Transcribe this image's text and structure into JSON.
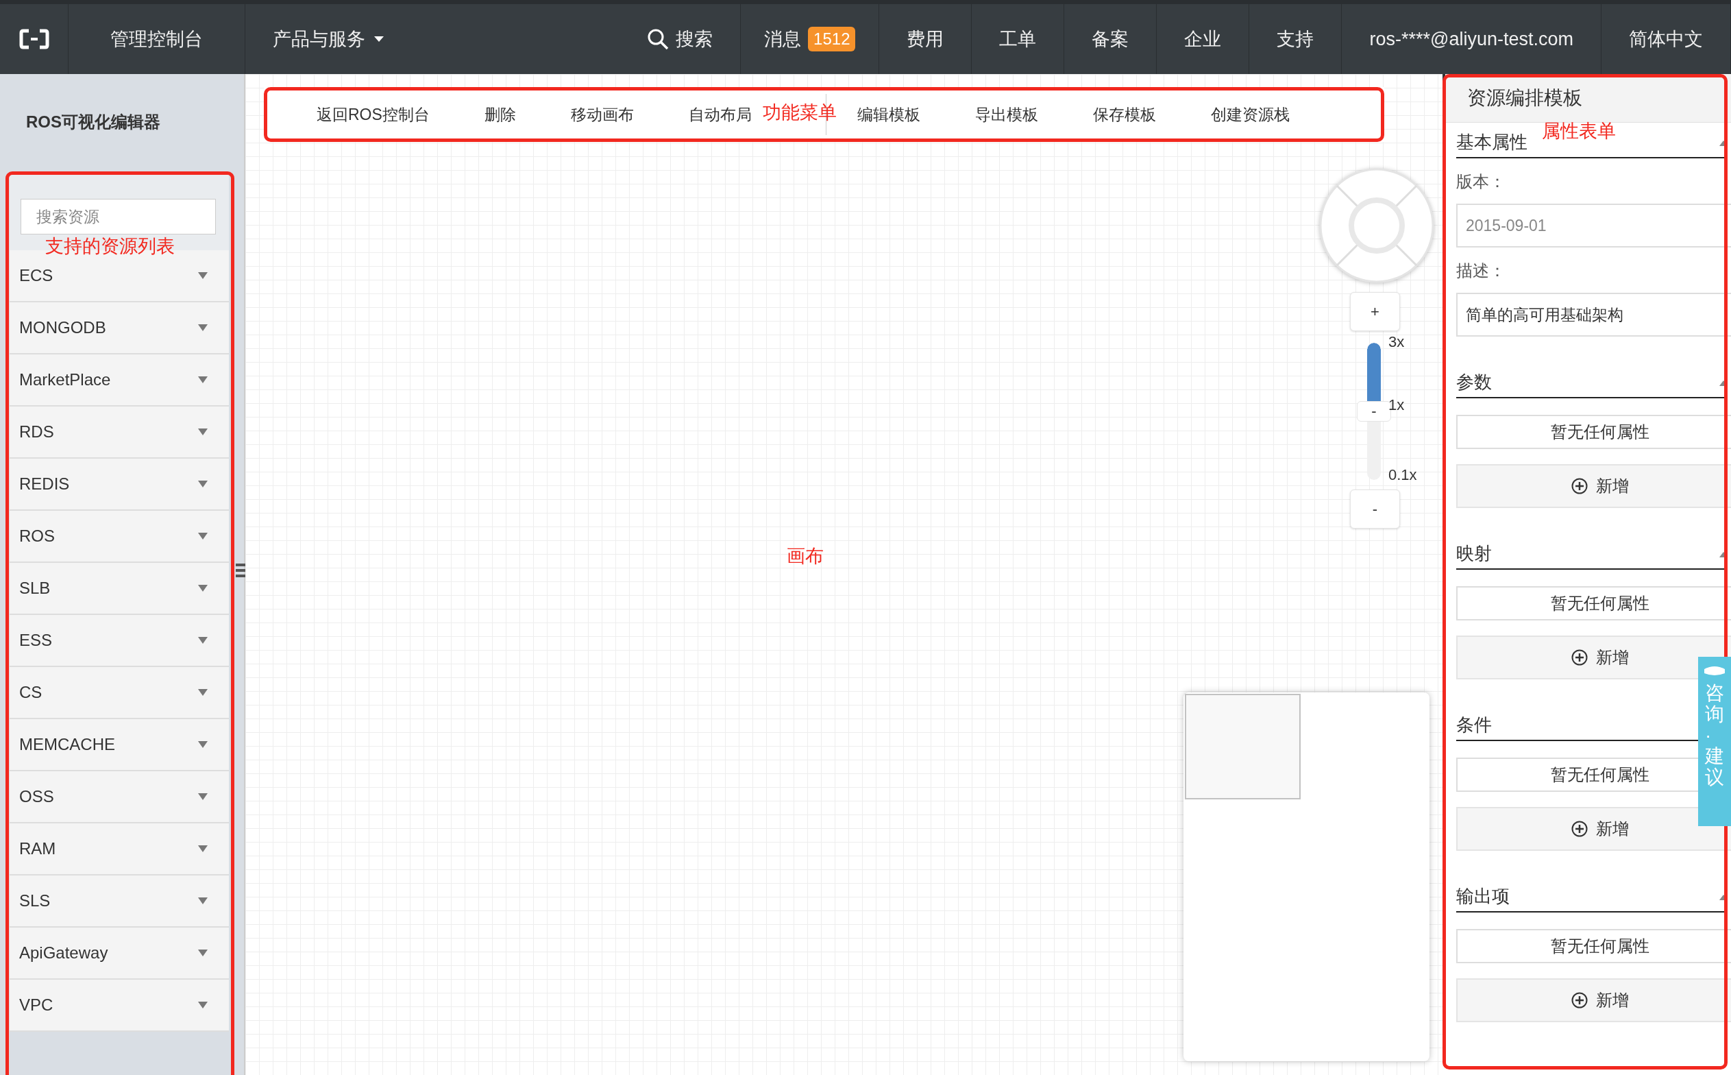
{
  "topbar": {
    "items": [
      {
        "kind": "logo"
      },
      {
        "kind": "link",
        "label": "管理控制台"
      },
      {
        "kind": "dropdown",
        "label": "产品与服务"
      },
      {
        "kind": "search",
        "label": "搜索"
      },
      {
        "kind": "badge",
        "label": "消息",
        "badge": "1512"
      },
      {
        "kind": "link",
        "label": "费用"
      },
      {
        "kind": "link",
        "label": "工单"
      },
      {
        "kind": "link",
        "label": "备案"
      },
      {
        "kind": "link",
        "label": "企业"
      },
      {
        "kind": "link",
        "label": "支持"
      },
      {
        "kind": "link",
        "label": "ros-****@aliyun-test.com"
      },
      {
        "kind": "link",
        "label": "简体中文"
      }
    ]
  },
  "sidebar": {
    "title": "ROS可视化编辑器",
    "search": {
      "placeholder": "搜索资源"
    },
    "annotation": "支持的资源列表",
    "items": [
      {
        "label": "ECS",
        "expanded": false
      },
      {
        "label": "MONGODB",
        "expanded": false
      },
      {
        "label": "MarketPlace",
        "expanded": false
      },
      {
        "label": "RDS",
        "expanded": false
      },
      {
        "label": "REDIS",
        "expanded": false
      },
      {
        "label": "ROS",
        "expanded": false
      },
      {
        "label": "SLB",
        "expanded": false
      },
      {
        "label": "ESS",
        "expanded": false
      },
      {
        "label": "CS",
        "expanded": false
      },
      {
        "label": "MEMCACHE",
        "expanded": false
      },
      {
        "label": "OSS",
        "expanded": false
      },
      {
        "label": "RAM",
        "expanded": false
      },
      {
        "label": "SLS",
        "expanded": false
      },
      {
        "label": "ApiGateway",
        "expanded": false
      },
      {
        "label": "VPC",
        "expanded": false
      }
    ]
  },
  "toolbar": {
    "annotation": "功能菜单",
    "buttons": [
      "返回ROS控制台",
      "删除",
      "移动画布",
      "自动布局",
      "编辑模板",
      "导出模板",
      "保存模板",
      "创建资源栈"
    ]
  },
  "canvas": {
    "annotation": "画布",
    "zoom": {
      "zoom_in": "+",
      "zoom_out": "-",
      "thumb": "-",
      "max_label": "3x",
      "mid_label": "1x",
      "min_label": "0.1x",
      "level": 0.5
    }
  },
  "properties": {
    "title": "资源编排模板",
    "annotation": "属性表单",
    "sections": [
      {
        "kind": "fields",
        "title": "基本属性",
        "fields": [
          {
            "label": "版本：",
            "placeholder": "2015-09-01"
          },
          {
            "label": "描述：",
            "value": "简单的高可用基础架构"
          }
        ]
      },
      {
        "kind": "list",
        "title": "参数",
        "empty": "暂无任何属性",
        "add": "新增"
      },
      {
        "kind": "list",
        "title": "映射",
        "empty": "暂无任何属性",
        "add": "新增"
      },
      {
        "kind": "list",
        "title": "条件",
        "empty": "暂无任何属性",
        "add": "新增"
      },
      {
        "kind": "list",
        "title": "输出项",
        "empty": "暂无任何属性",
        "add": "新增"
      }
    ]
  },
  "feedback_tab": {
    "label": "咨询·建议"
  }
}
